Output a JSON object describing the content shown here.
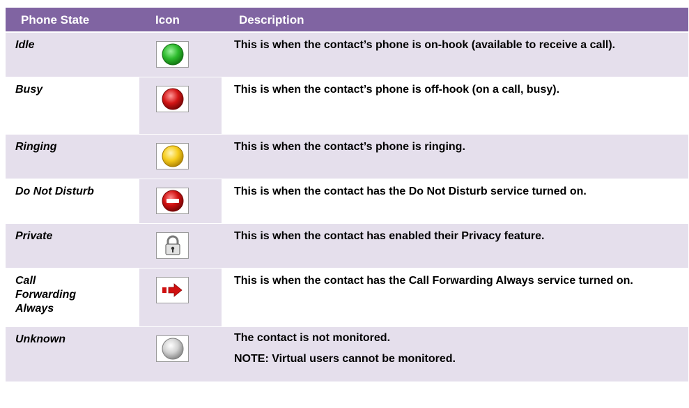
{
  "header": {
    "phone_state": "Phone State",
    "icon": "Icon",
    "description": "Description"
  },
  "rows": [
    {
      "state": "Idle",
      "icon": "idle-green-circle-icon",
      "desc": "This is when the contact’s phone is on-hook (available to receive a call)."
    },
    {
      "state": "Busy",
      "icon": "busy-red-circle-icon",
      "desc": "This is when the contact’s phone is off-hook (on a call, busy)."
    },
    {
      "state": "Ringing",
      "icon": "ringing-yellow-circle-icon",
      "desc": "This is when the contact’s phone is ringing."
    },
    {
      "state": "Do Not Disturb",
      "icon": "do-not-disturb-icon",
      "desc": "This is when the contact has the Do Not Disturb service turned on."
    },
    {
      "state": "Private",
      "icon": "padlock-icon",
      "desc": "This is when the contact has enabled their Privacy feature."
    },
    {
      "state": "Call Forwarding Always",
      "icon": "call-forward-arrow-icon",
      "desc": "This is when the contact has the Call Forwarding Always service turned on."
    },
    {
      "state": "Unknown",
      "icon": "unknown-gray-circle-icon",
      "desc": "The contact is not monitored.",
      "note": "NOTE:  Virtual users cannot be monitored."
    }
  ],
  "colors": {
    "header_bg": "#8064a2",
    "row_shade": "#e5dfec",
    "idle": "#22b022",
    "busy": "#d01010",
    "ringing": "#f6cc1c",
    "unknown": "#c8c8c8"
  }
}
